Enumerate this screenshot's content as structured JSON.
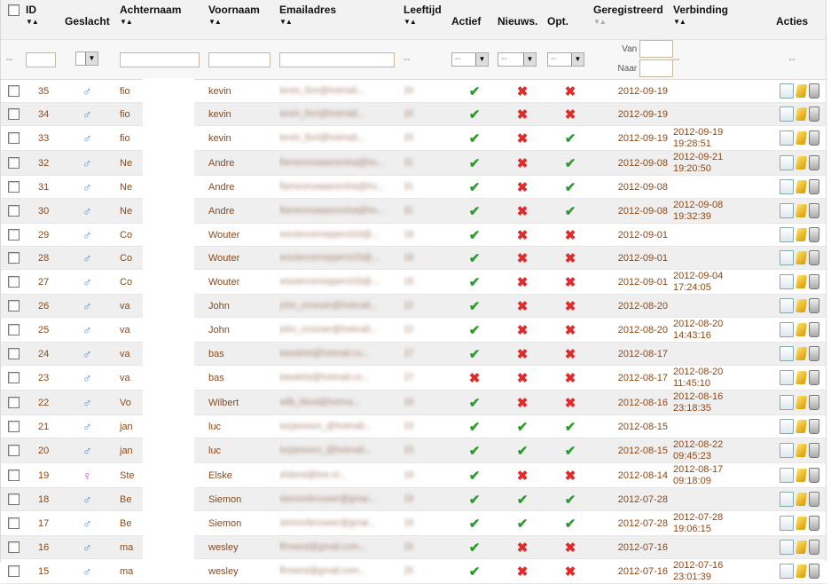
{
  "headers": {
    "id": "ID",
    "gender": "Geslacht",
    "lastname": "Achternaam",
    "firstname": "Voornaam",
    "email": "Emailadres",
    "age": "Leeftijd",
    "active": "Actief",
    "news": "Nieuws.",
    "opt": "Opt.",
    "registered": "Geregistreerd",
    "connection": "Verbinding",
    "actions": "Acties"
  },
  "filter": {
    "dash": "--",
    "select_dash": "--",
    "van": "Van",
    "naar": "Naar"
  },
  "rows": [
    {
      "id": "35",
      "gender": "male",
      "last": "fio",
      "first": "kevin",
      "email": "kevin_fiori@hotmail...",
      "age": "20",
      "active": "ok",
      "news": "no",
      "opt": "no",
      "reg": "2012-09-19",
      "conn": [
        "",
        ""
      ]
    },
    {
      "id": "34",
      "gender": "male",
      "last": "fio",
      "first": "kevin",
      "email": "kevin_fiori@hotmail...",
      "age": "20",
      "active": "ok",
      "news": "no",
      "opt": "no",
      "reg": "2012-09-19",
      "conn": [
        "",
        ""
      ]
    },
    {
      "id": "33",
      "gender": "male",
      "last": "fio",
      "first": "kevin",
      "email": "kevin_fiori@hotmail...",
      "age": "20",
      "active": "ok",
      "news": "no",
      "opt": "ok",
      "reg": "2012-09-19",
      "conn": [
        "2012-09-19",
        "19:28:51"
      ]
    },
    {
      "id": "32",
      "gender": "male",
      "last": "Ne",
      "first": "Andre",
      "email": "flameonuaaanorsha@ho...",
      "age": "31",
      "active": "ok",
      "news": "no",
      "opt": "ok",
      "reg": "2012-09-08",
      "conn": [
        "2012-09-21",
        "19:20:50"
      ]
    },
    {
      "id": "31",
      "gender": "male",
      "last": "Ne",
      "first": "Andre",
      "email": "flameonuaaanorsha@ho...",
      "age": "31",
      "active": "ok",
      "news": "no",
      "opt": "ok",
      "reg": "2012-09-08",
      "conn": [
        "",
        ""
      ]
    },
    {
      "id": "30",
      "gender": "male",
      "last": "Ne",
      "first": "Andre",
      "email": "flameonuaaanorsha@ho...",
      "age": "31",
      "active": "ok",
      "news": "no",
      "opt": "ok",
      "reg": "2012-09-08",
      "conn": [
        "2012-09-08",
        "19:32:39"
      ]
    },
    {
      "id": "29",
      "gender": "male",
      "last": "Co",
      "first": "Wouter",
      "email": "woutercorneppen103@...",
      "age": "18",
      "active": "ok",
      "news": "no",
      "opt": "no",
      "reg": "2012-09-01",
      "conn": [
        "",
        ""
      ]
    },
    {
      "id": "28",
      "gender": "male",
      "last": "Co",
      "first": "Wouter",
      "email": "woutercorneppen103@...",
      "age": "18",
      "active": "ok",
      "news": "no",
      "opt": "no",
      "reg": "2012-09-01",
      "conn": [
        "",
        ""
      ]
    },
    {
      "id": "27",
      "gender": "male",
      "last": "Co",
      "first": "Wouter",
      "email": "woutercorneppen103@...",
      "age": "18",
      "active": "ok",
      "news": "no",
      "opt": "no",
      "reg": "2012-09-01",
      "conn": [
        "2012-09-04",
        "17:24:05"
      ]
    },
    {
      "id": "26",
      "gender": "male",
      "last": "va",
      "first": "John",
      "email": "john_crossan@hotmail...",
      "age": "22",
      "active": "ok",
      "news": "no",
      "opt": "no",
      "reg": "2012-08-20",
      "conn": [
        "",
        ""
      ]
    },
    {
      "id": "25",
      "gender": "male",
      "last": "va",
      "first": "John",
      "email": "john_crossan@hotmail...",
      "age": "22",
      "active": "ok",
      "news": "no",
      "opt": "no",
      "reg": "2012-08-20",
      "conn": [
        "2012-08-20",
        "14:43:16"
      ]
    },
    {
      "id": "24",
      "gender": "male",
      "last": "va",
      "first": "bas",
      "email": "basdelst@hotmail.co...",
      "age": "27",
      "active": "ok",
      "news": "no",
      "opt": "no",
      "reg": "2012-08-17",
      "conn": [
        "",
        ""
      ]
    },
    {
      "id": "23",
      "gender": "male",
      "last": "va",
      "first": "bas",
      "email": "basdelst@hotmail.co...",
      "age": "27",
      "active": "no",
      "news": "no",
      "opt": "no",
      "reg": "2012-08-17",
      "conn": [
        "2012-08-20",
        "11:45:10"
      ]
    },
    {
      "id": "22",
      "gender": "male",
      "last": "Vo",
      "first": "Wilbert",
      "email": "wilb_bloot@hotma...",
      "age": "19",
      "active": "ok",
      "news": "no",
      "opt": "no",
      "reg": "2012-08-16",
      "conn": [
        "2012-08-16",
        "23:18:35"
      ]
    },
    {
      "id": "21",
      "gender": "male",
      "last": "jan",
      "first": "luc",
      "email": "lucjansson_@hotmail...",
      "age": "23",
      "active": "ok",
      "news": "ok",
      "opt": "ok",
      "reg": "2012-08-15",
      "conn": [
        "",
        ""
      ]
    },
    {
      "id": "20",
      "gender": "male",
      "last": "jan",
      "first": "luc",
      "email": "lucjansson_@hotmail...",
      "age": "23",
      "active": "ok",
      "news": "ok",
      "opt": "ok",
      "reg": "2012-08-15",
      "conn": [
        "2012-08-22",
        "09:45:23"
      ]
    },
    {
      "id": "19",
      "gender": "female",
      "last": "Ste",
      "first": "Elske",
      "email": "elskest@live.nl...",
      "age": "18",
      "active": "ok",
      "news": "no",
      "opt": "no",
      "reg": "2012-08-14",
      "conn": [
        "2012-08-17",
        "09:18:09"
      ]
    },
    {
      "id": "18",
      "gender": "male",
      "last": "Be",
      "first": "Siemon",
      "email": "siemonbrouwer@gmai...",
      "age": "19",
      "active": "ok",
      "news": "ok",
      "opt": "ok",
      "reg": "2012-07-28",
      "conn": [
        "",
        ""
      ]
    },
    {
      "id": "17",
      "gender": "male",
      "last": "Be",
      "first": "Siemon",
      "email": "siemonbrouwer@gmai...",
      "age": "19",
      "active": "ok",
      "news": "ok",
      "opt": "ok",
      "reg": "2012-07-28",
      "conn": [
        "2012-07-28",
        "19:06:15"
      ]
    },
    {
      "id": "16",
      "gender": "male",
      "last": "ma",
      "first": "wesley",
      "email": "ffmwesl@gmail.com...",
      "age": "25",
      "active": "ok",
      "news": "no",
      "opt": "no",
      "reg": "2012-07-16",
      "conn": [
        "",
        ""
      ]
    },
    {
      "id": "15",
      "gender": "male",
      "last": "ma",
      "first": "wesley",
      "email": "ffmwesl@gmail.com...",
      "age": "25",
      "active": "ok",
      "news": "no",
      "opt": "no",
      "reg": "2012-07-16",
      "conn": [
        "2012-07-16",
        "23:01:39"
      ]
    }
  ]
}
